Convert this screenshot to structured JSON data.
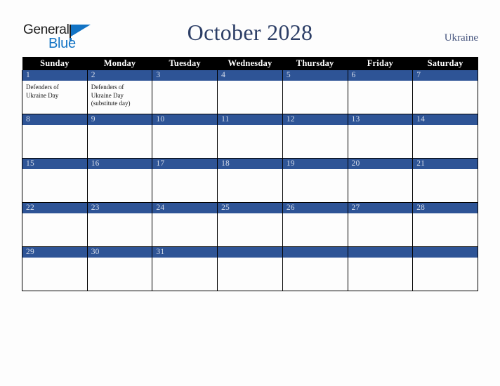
{
  "brand": {
    "name_part1": "General",
    "name_part2": "Blue",
    "triangle_color": "#1273c4"
  },
  "header": {
    "title": "October 2028",
    "country": "Ukraine",
    "title_color": "#2c3e66",
    "country_color": "#46557e"
  },
  "calendar": {
    "weekday_headers": [
      "Sunday",
      "Monday",
      "Tuesday",
      "Wednesday",
      "Thursday",
      "Friday",
      "Saturday"
    ],
    "header_bg": "#000000",
    "daynum_bg": "#2e5496",
    "daynum_color": "#d5dcea",
    "weeks": [
      [
        {
          "day": "1",
          "events": [
            "Defenders of",
            "Ukraine Day"
          ]
        },
        {
          "day": "2",
          "events": [
            "Defenders of",
            "Ukraine Day",
            "(substitute day)"
          ]
        },
        {
          "day": "3",
          "events": []
        },
        {
          "day": "4",
          "events": []
        },
        {
          "day": "5",
          "events": []
        },
        {
          "day": "6",
          "events": []
        },
        {
          "day": "7",
          "events": []
        }
      ],
      [
        {
          "day": "8",
          "events": []
        },
        {
          "day": "9",
          "events": []
        },
        {
          "day": "10",
          "events": []
        },
        {
          "day": "11",
          "events": []
        },
        {
          "day": "12",
          "events": []
        },
        {
          "day": "13",
          "events": []
        },
        {
          "day": "14",
          "events": []
        }
      ],
      [
        {
          "day": "15",
          "events": []
        },
        {
          "day": "16",
          "events": []
        },
        {
          "day": "17",
          "events": []
        },
        {
          "day": "18",
          "events": []
        },
        {
          "day": "19",
          "events": []
        },
        {
          "day": "20",
          "events": []
        },
        {
          "day": "21",
          "events": []
        }
      ],
      [
        {
          "day": "22",
          "events": []
        },
        {
          "day": "23",
          "events": []
        },
        {
          "day": "24",
          "events": []
        },
        {
          "day": "25",
          "events": []
        },
        {
          "day": "26",
          "events": []
        },
        {
          "day": "27",
          "events": []
        },
        {
          "day": "28",
          "events": []
        }
      ],
      [
        {
          "day": "29",
          "events": []
        },
        {
          "day": "30",
          "events": []
        },
        {
          "day": "31",
          "events": []
        },
        {
          "day": "",
          "events": []
        },
        {
          "day": "",
          "events": []
        },
        {
          "day": "",
          "events": []
        },
        {
          "day": "",
          "events": []
        }
      ]
    ]
  }
}
